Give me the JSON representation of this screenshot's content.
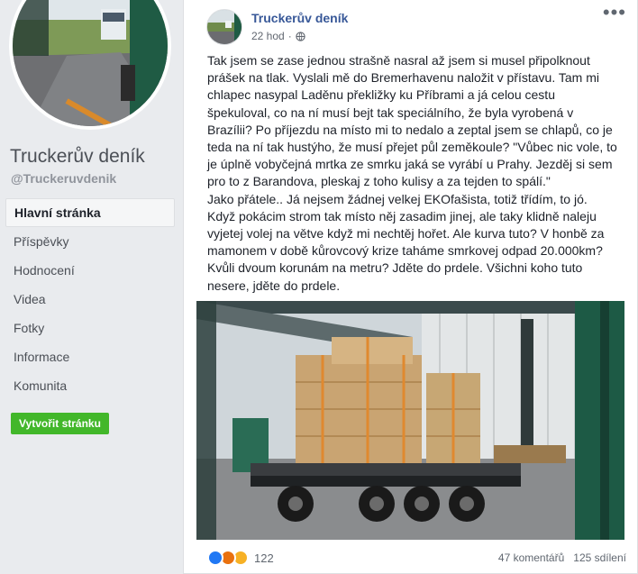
{
  "sidebar": {
    "page_name": "Truckerův deník",
    "handle": "@Truckeruvdenik",
    "nav": [
      {
        "label": "Hlavní stránka",
        "active": true
      },
      {
        "label": "Příspěvky"
      },
      {
        "label": "Hodnocení"
      },
      {
        "label": "Videa"
      },
      {
        "label": "Fotky"
      },
      {
        "label": "Informace"
      },
      {
        "label": "Komunita"
      }
    ],
    "create_page_label": "Vytvořit stránku"
  },
  "post": {
    "author": "Truckerův deník",
    "time": "22 hod",
    "more_label": "•••",
    "privacy_icon": "globe-icon",
    "text": "Tak jsem se zase jednou strašně nasral až jsem si musel připolknout prášek na tlak. Vyslali mě do Bremerhavenu naložit v přístavu. Tam mi chlapec nasypal Laděnu překližky ku Příbrami a já celou cestu špekuloval, co na ní musí bejt tak speciálního, že byla vyrobená v Brazílii? Po příjezdu na místo mi to nedalo a zeptal jsem se chlapů, co je teda na ní tak hustýho, že musí přejet půl zeměkoule? \"Vůbec nic vole, to je úplně vobyčejná mrtka ze smrku jaká se vyrábí u Prahy. Jezděj si sem pro to z Barandova, pleskaj z toho kulisy a za tejden to spálí.\"\nJako přátele.. Já nejsem žádnej velkej EKOfašista, totiž třídím, to jó. Když pokácim strom tak místo něj zasadim jinej, ale taky klidně naleju vyjetej volej na větve když mi nechtěj hořet. Ale kurva tuto? V honbě za mamonem v době kůrovcový krize taháme smrkovej odpad 20.000km? Kvůli dvoum korunám na metru? Jděte do prdele. Všichni koho tuto nesere, jděte do prdele.",
    "reactions_count": "122",
    "reaction_icons": [
      "like-icon",
      "angry-icon",
      "haha-icon"
    ],
    "comments": "47 komentářů",
    "shares": "125 sdílení"
  },
  "colors": {
    "link": "#385898",
    "create_button": "#42b72a",
    "like": "#2078f4",
    "angry": "#e9710f",
    "haha": "#f7b125"
  }
}
